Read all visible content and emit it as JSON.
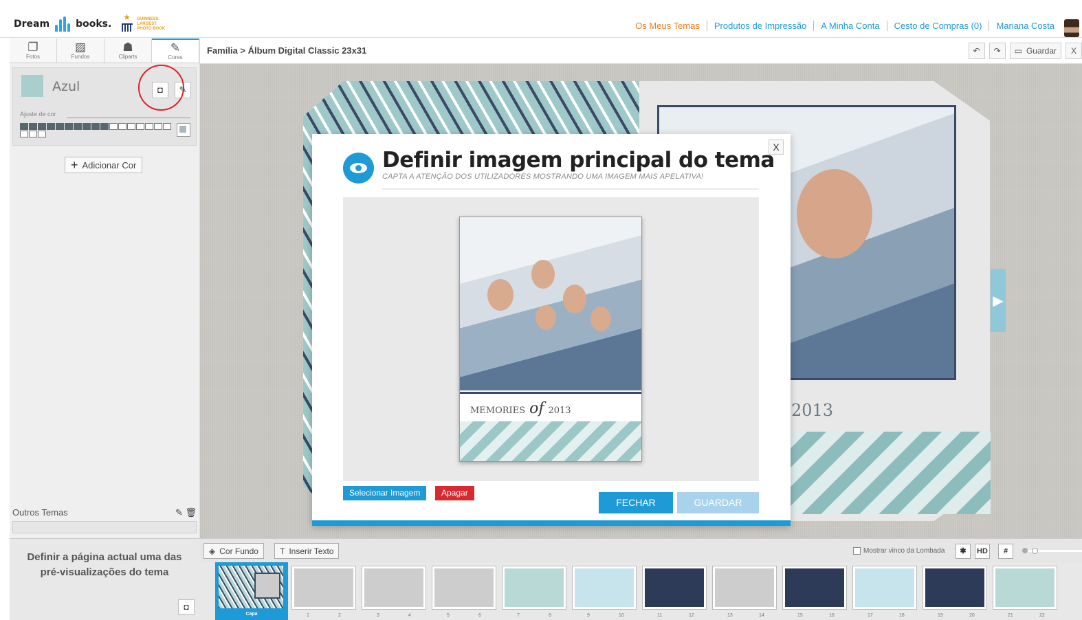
{
  "header": {
    "logo": {
      "left": "Dream",
      "right": "books.",
      "record": [
        "GUINNESS",
        "LARGEST",
        "PHOTO BOOK"
      ]
    },
    "nav": [
      "Os Meus Temas",
      "Produtos de Impressão",
      "A Minha Conta",
      "Cesto de Compras (0)",
      "Mariana Costa"
    ]
  },
  "tools": {
    "tabs": [
      {
        "label": "Fotos",
        "icon": "photos-icon"
      },
      {
        "label": "Fundos",
        "icon": "backgrounds-icon"
      },
      {
        "label": "Cliparts",
        "icon": "cliparts-icon"
      },
      {
        "label": "Cores",
        "icon": "colors-icon"
      }
    ],
    "active": "Cores"
  },
  "color_panel": {
    "name": "Azul",
    "swatch": "#a8cece",
    "adjust_label": "Ajuste de cor",
    "add_color": "Adicionar Cor"
  },
  "other_themes": {
    "label": "Outros Temas"
  },
  "define_box": {
    "text": "Definir a página actual uma das pré-visualizações do tema"
  },
  "breadcrumb": "Família > Álbum Digital Classic 23x31",
  "toolbar": {
    "save": "Guardar",
    "close": "X"
  },
  "album": {
    "year": "2013"
  },
  "modal": {
    "title": "Definir imagem principal do tema",
    "subtitle": "CAPTA A ATENÇÃO DOS UTILIZADORES MOSTRANDO UMA IMAGEM MAIS APELATIVA!",
    "close": "X",
    "preview_caption": {
      "left": "MEMORIES",
      "mid": "of",
      "right": "2013"
    },
    "select_image": "Selecionar Imagem",
    "delete": "Apagar",
    "close_button": "FECHAR",
    "save_button": "GUARDAR"
  },
  "bottom": {
    "bg_color": "Cor Fundo",
    "insert_text": "Inserir Texto",
    "show_spine": "Mostrar vinco da Lombada",
    "hd": "HD"
  },
  "filmstrip": {
    "cover": "Capa",
    "pages": [
      "1",
      "2",
      "3",
      "4",
      "5",
      "6",
      "7",
      "8",
      "9",
      "10",
      "11",
      "12",
      "13",
      "14",
      "15",
      "16",
      "17",
      "18",
      "19",
      "20",
      "21",
      "22"
    ]
  },
  "colors": {
    "accent": "#1e9ad6",
    "danger": "#d9282e",
    "orange": "#f07e1a"
  }
}
